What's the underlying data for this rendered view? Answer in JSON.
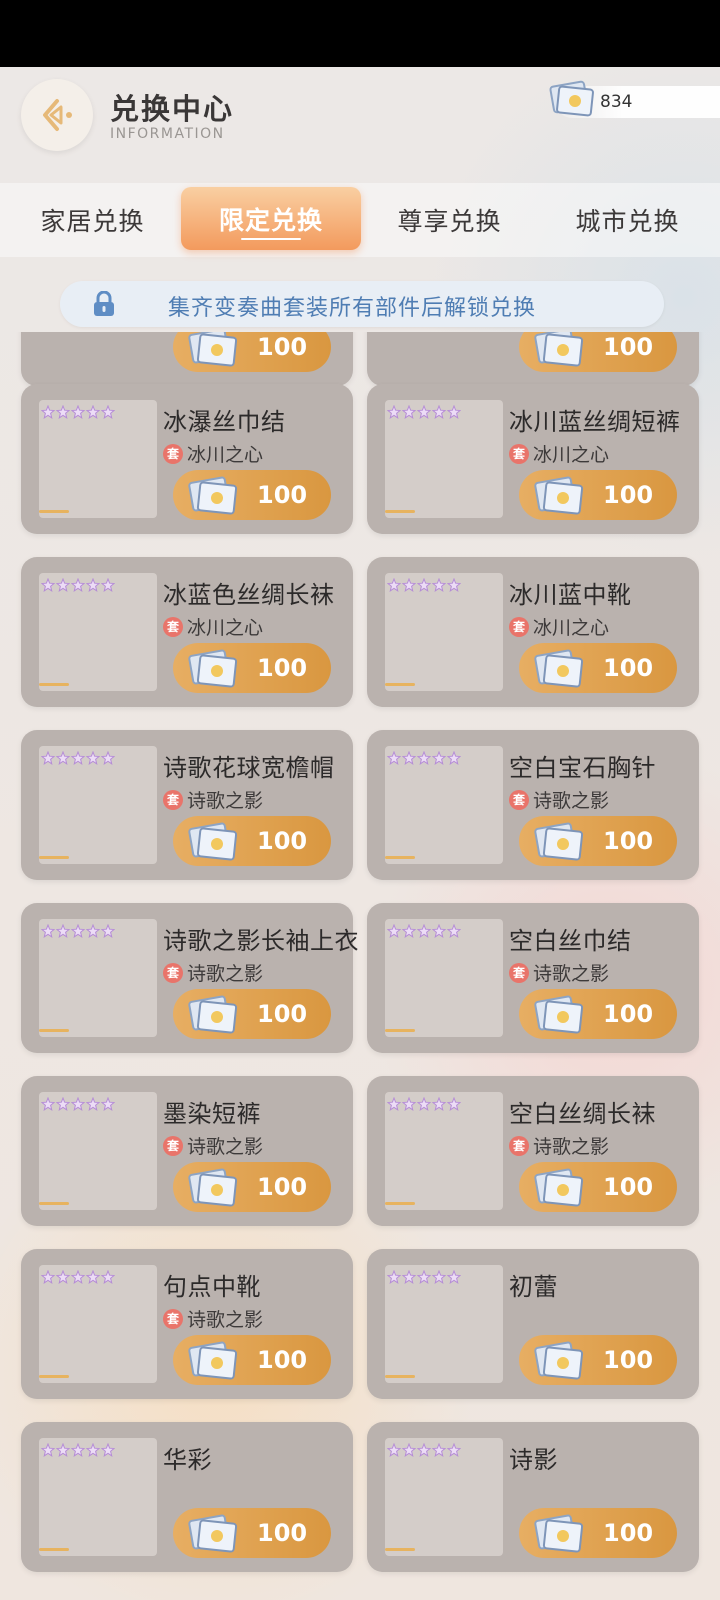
{
  "header": {
    "title": "兑换中心",
    "subtitle": "INFORMATION",
    "currency_value": "834"
  },
  "tabs": [
    {
      "label": "家居兑换",
      "active": false
    },
    {
      "label": "限定兑换",
      "active": true
    },
    {
      "label": "尊享兑换",
      "active": false
    },
    {
      "label": "城市兑换",
      "active": false
    }
  ],
  "notice": {
    "text": "集齐变奏曲套装所有部件后解锁兑换"
  },
  "top_partial": [
    {
      "price": "100"
    },
    {
      "price": "100"
    }
  ],
  "items": [
    {
      "name": "冰瀑丝巾结",
      "set": "冰川之心",
      "price": "100"
    },
    {
      "name": "冰川蓝丝绸短裤",
      "set": "冰川之心",
      "price": "100"
    },
    {
      "name": "冰蓝色丝绸长袜",
      "set": "冰川之心",
      "price": "100"
    },
    {
      "name": "冰川蓝中靴",
      "set": "冰川之心",
      "price": "100"
    },
    {
      "name": "诗歌花球宽檐帽",
      "set": "诗歌之影",
      "price": "100"
    },
    {
      "name": "空白宝石胸针",
      "set": "诗歌之影",
      "price": "100"
    },
    {
      "name": "诗歌之影长袖上衣",
      "set": "诗歌之影",
      "price": "100"
    },
    {
      "name": "空白丝巾结",
      "set": "诗歌之影",
      "price": "100"
    },
    {
      "name": "墨染短裤",
      "set": "诗歌之影",
      "price": "100"
    },
    {
      "name": "空白丝绸长袜",
      "set": "诗歌之影",
      "price": "100"
    },
    {
      "name": "句点中靴",
      "set": "诗歌之影",
      "price": "100"
    },
    {
      "name": "初蕾",
      "set": "",
      "price": "100"
    },
    {
      "name": "华彩",
      "set": "",
      "price": "100"
    },
    {
      "name": "诗影",
      "set": "",
      "price": "100"
    }
  ],
  "set_badge": "套",
  "colors": {
    "accent": "#f39a5d",
    "price_pill": "#dea14f",
    "set_badge": "#e9746a",
    "notice_text": "#4f7db3"
  }
}
